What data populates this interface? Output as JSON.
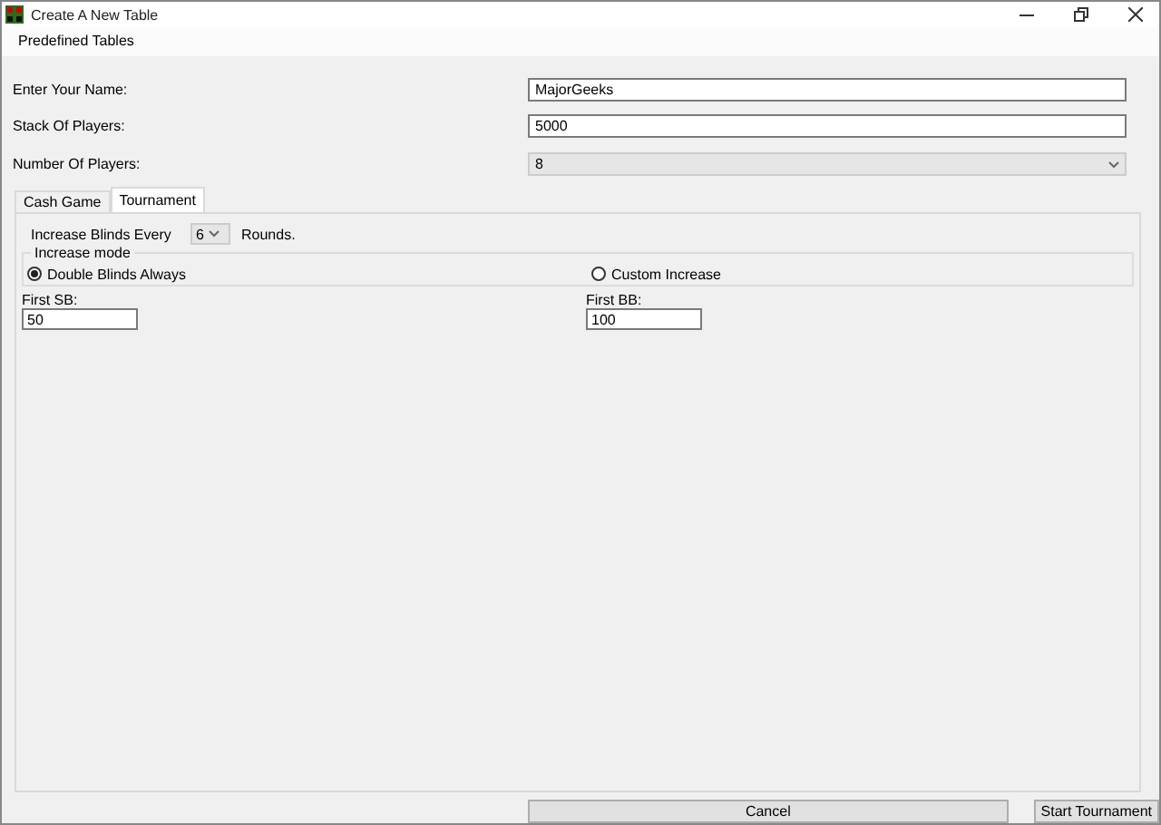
{
  "window": {
    "title": "Create A New Table"
  },
  "menu": [
    "Predefined Tables"
  ],
  "form": [
    {
      "label": "Enter Your Name:",
      "kind": "text",
      "value": "MajorGeeks"
    },
    {
      "label": "Stack Of Players:",
      "kind": "text",
      "value": "5000"
    },
    {
      "label": "Number Of Players:",
      "kind": "select",
      "value": "8"
    }
  ],
  "tabs": [
    {
      "label": "Cash Game",
      "selected": false
    },
    {
      "label": "Tournament",
      "selected": true
    }
  ],
  "tournament": {
    "increase_label": "Increase Blinds Every",
    "increase_value": "6",
    "increase_suffix": "Rounds.",
    "group_title": "Increase mode",
    "modes": [
      {
        "label": "Double Blinds Always",
        "selected": true,
        "field_label": "First SB:",
        "field_value": "50"
      },
      {
        "label": "Custom Increase",
        "selected": false,
        "field_label": "First BB:",
        "field_value": "100"
      }
    ]
  },
  "buttons": [
    {
      "label": "Cancel",
      "kind": "wide"
    },
    {
      "label": "Start Tournament",
      "kind": "normal"
    }
  ]
}
